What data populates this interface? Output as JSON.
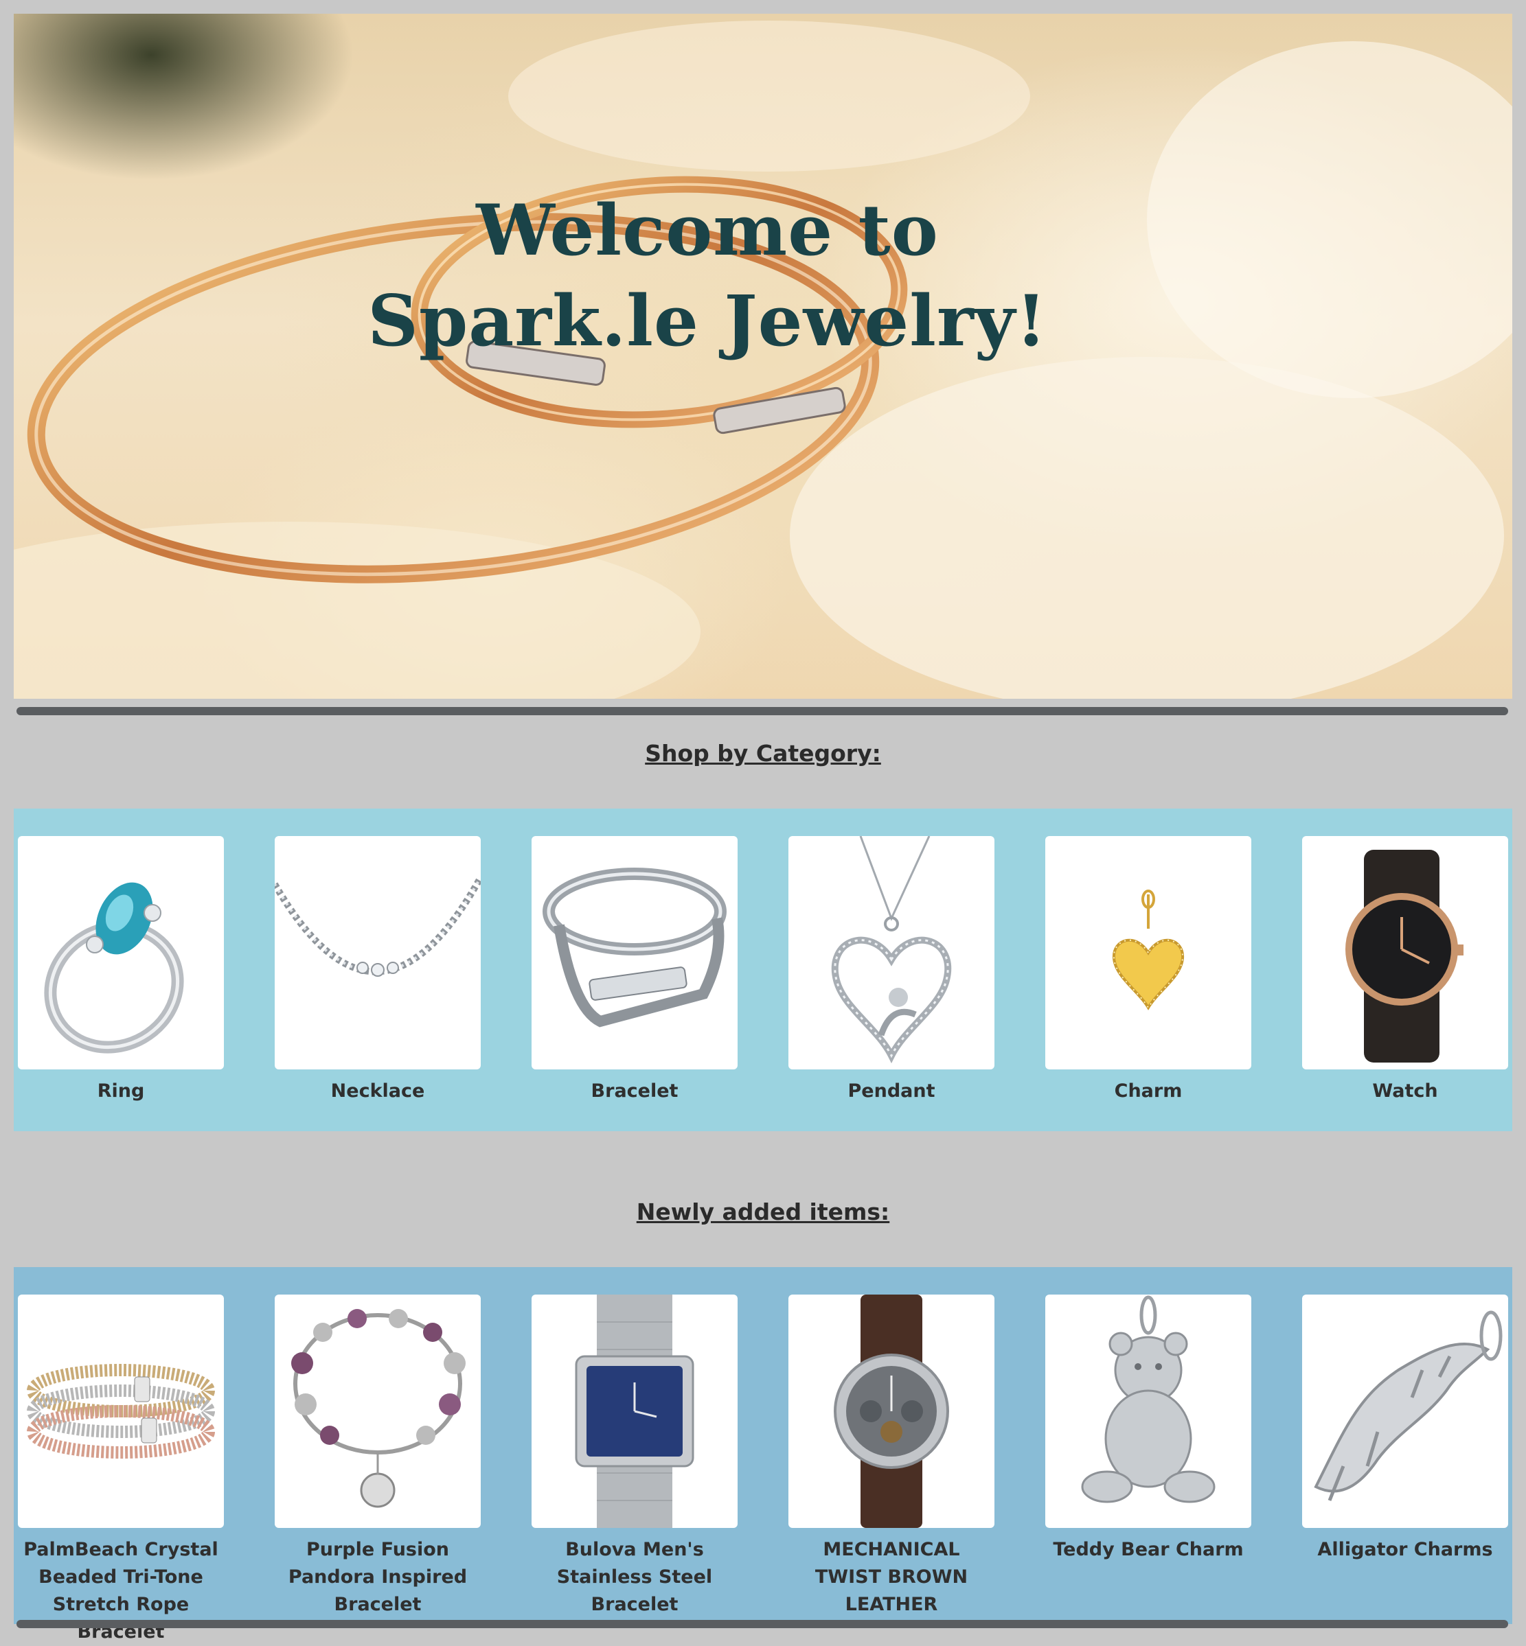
{
  "hero": {
    "title_line1": "Welcome to",
    "title_line2": "Spark.le Jewelry!"
  },
  "categories": {
    "heading": "Shop by Category:",
    "items": [
      {
        "label": "Ring",
        "icon": "ring-icon"
      },
      {
        "label": "Necklace",
        "icon": "necklace-icon"
      },
      {
        "label": "Bracelet",
        "icon": "bracelet-icon"
      },
      {
        "label": "Pendant",
        "icon": "pendant-icon"
      },
      {
        "label": "Charm",
        "icon": "charm-icon"
      },
      {
        "label": "Watch",
        "icon": "watch-icon"
      }
    ]
  },
  "new_items": {
    "heading": "Newly added items:",
    "items": [
      {
        "label": "PalmBeach Crystal Beaded Tri-Tone Stretch Rope Bracelet"
      },
      {
        "label": "Purple Fusion Pandora Inspired Bracelet"
      },
      {
        "label": "Bulova Men's Stainless Steel Bracelet"
      },
      {
        "label": "MECHANICAL TWIST BROWN LEATHER"
      },
      {
        "label": "Teddy Bear Charm"
      },
      {
        "label": "Alligator Charms"
      }
    ]
  },
  "colors": {
    "page_background": "#c8c8c8",
    "category_band": "#9bd3e0",
    "new_items_band": "#89bcd6",
    "hero_title": "#1a4348",
    "divider": "#5a5d60"
  }
}
